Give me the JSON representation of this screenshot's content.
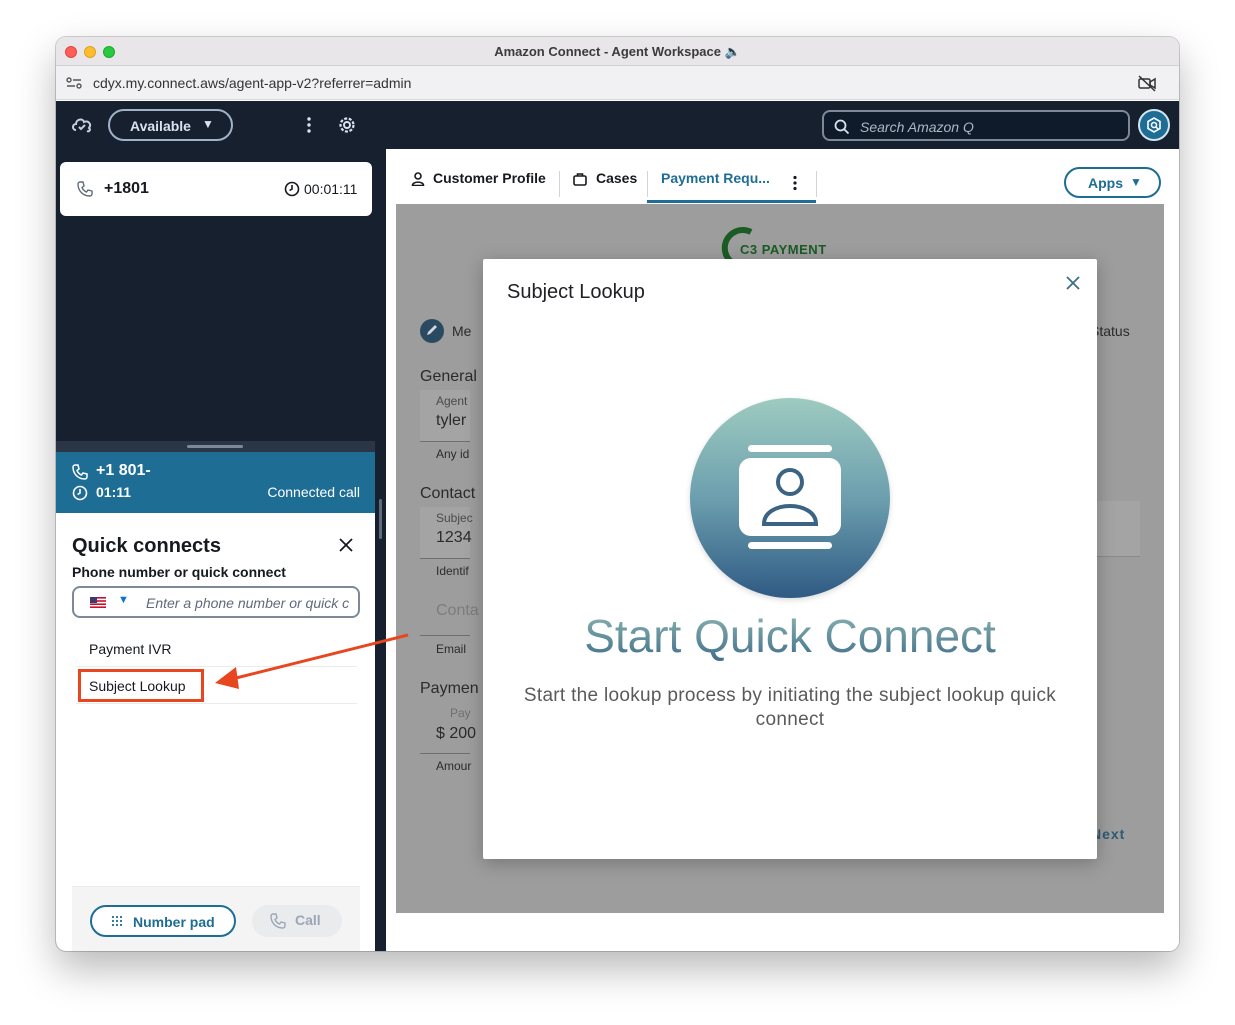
{
  "window": {
    "title": "Amazon Connect - Agent Workspace 🔈",
    "url": "cdyx.my.connect.aws/agent-app-v2?referrer=admin"
  },
  "agent": {
    "status_label": "Available"
  },
  "contact_card": {
    "number": "+1801",
    "elapsed": "00:01:11"
  },
  "call_banner": {
    "number": "+1 801-",
    "time": "01:11",
    "status": "Connected call"
  },
  "quick_connects": {
    "title": "Quick connects",
    "field_label": "Phone number or quick connect",
    "placeholder": "Enter a phone number or quick c",
    "items": [
      {
        "label": "Payment IVR"
      },
      {
        "label": "Subject Lookup"
      }
    ],
    "number_pad_label": "Number pad",
    "call_label": "Call"
  },
  "topbar": {
    "search_placeholder": "Search Amazon Q"
  },
  "tabs": [
    {
      "label": "Customer Profile",
      "icon": "user-icon"
    },
    {
      "label": "Cases",
      "icon": "briefcase-icon"
    },
    {
      "label": "Payment Requ...",
      "active": true
    }
  ],
  "apps_label": "Apps",
  "background_app": {
    "logo_text": "C3 PAYMENT",
    "status_label": "Status",
    "method_label": "Me",
    "general_label": "General",
    "agent_label": "Agent",
    "agent_value": "tyler",
    "any_id_label": "Any id",
    "contact_label": "Contact",
    "subject_label": "Subjec",
    "subject_value": "1234",
    "identify_label": "Identif",
    "contact_input": "Conta",
    "email_label": "Email",
    "payment_label": "Paymen",
    "pay_label": "Pay",
    "amount_value": "$ 200",
    "amount_label": "Amour",
    "next_label": "Next"
  },
  "modal": {
    "title": "Subject Lookup",
    "heading": "Start Quick Connect",
    "description": "Start the lookup process by initiating the subject lookup quick connect"
  },
  "colors": {
    "dark_nav": "#16202f",
    "accent": "#1e6d95",
    "highlight": "#e8461e"
  }
}
